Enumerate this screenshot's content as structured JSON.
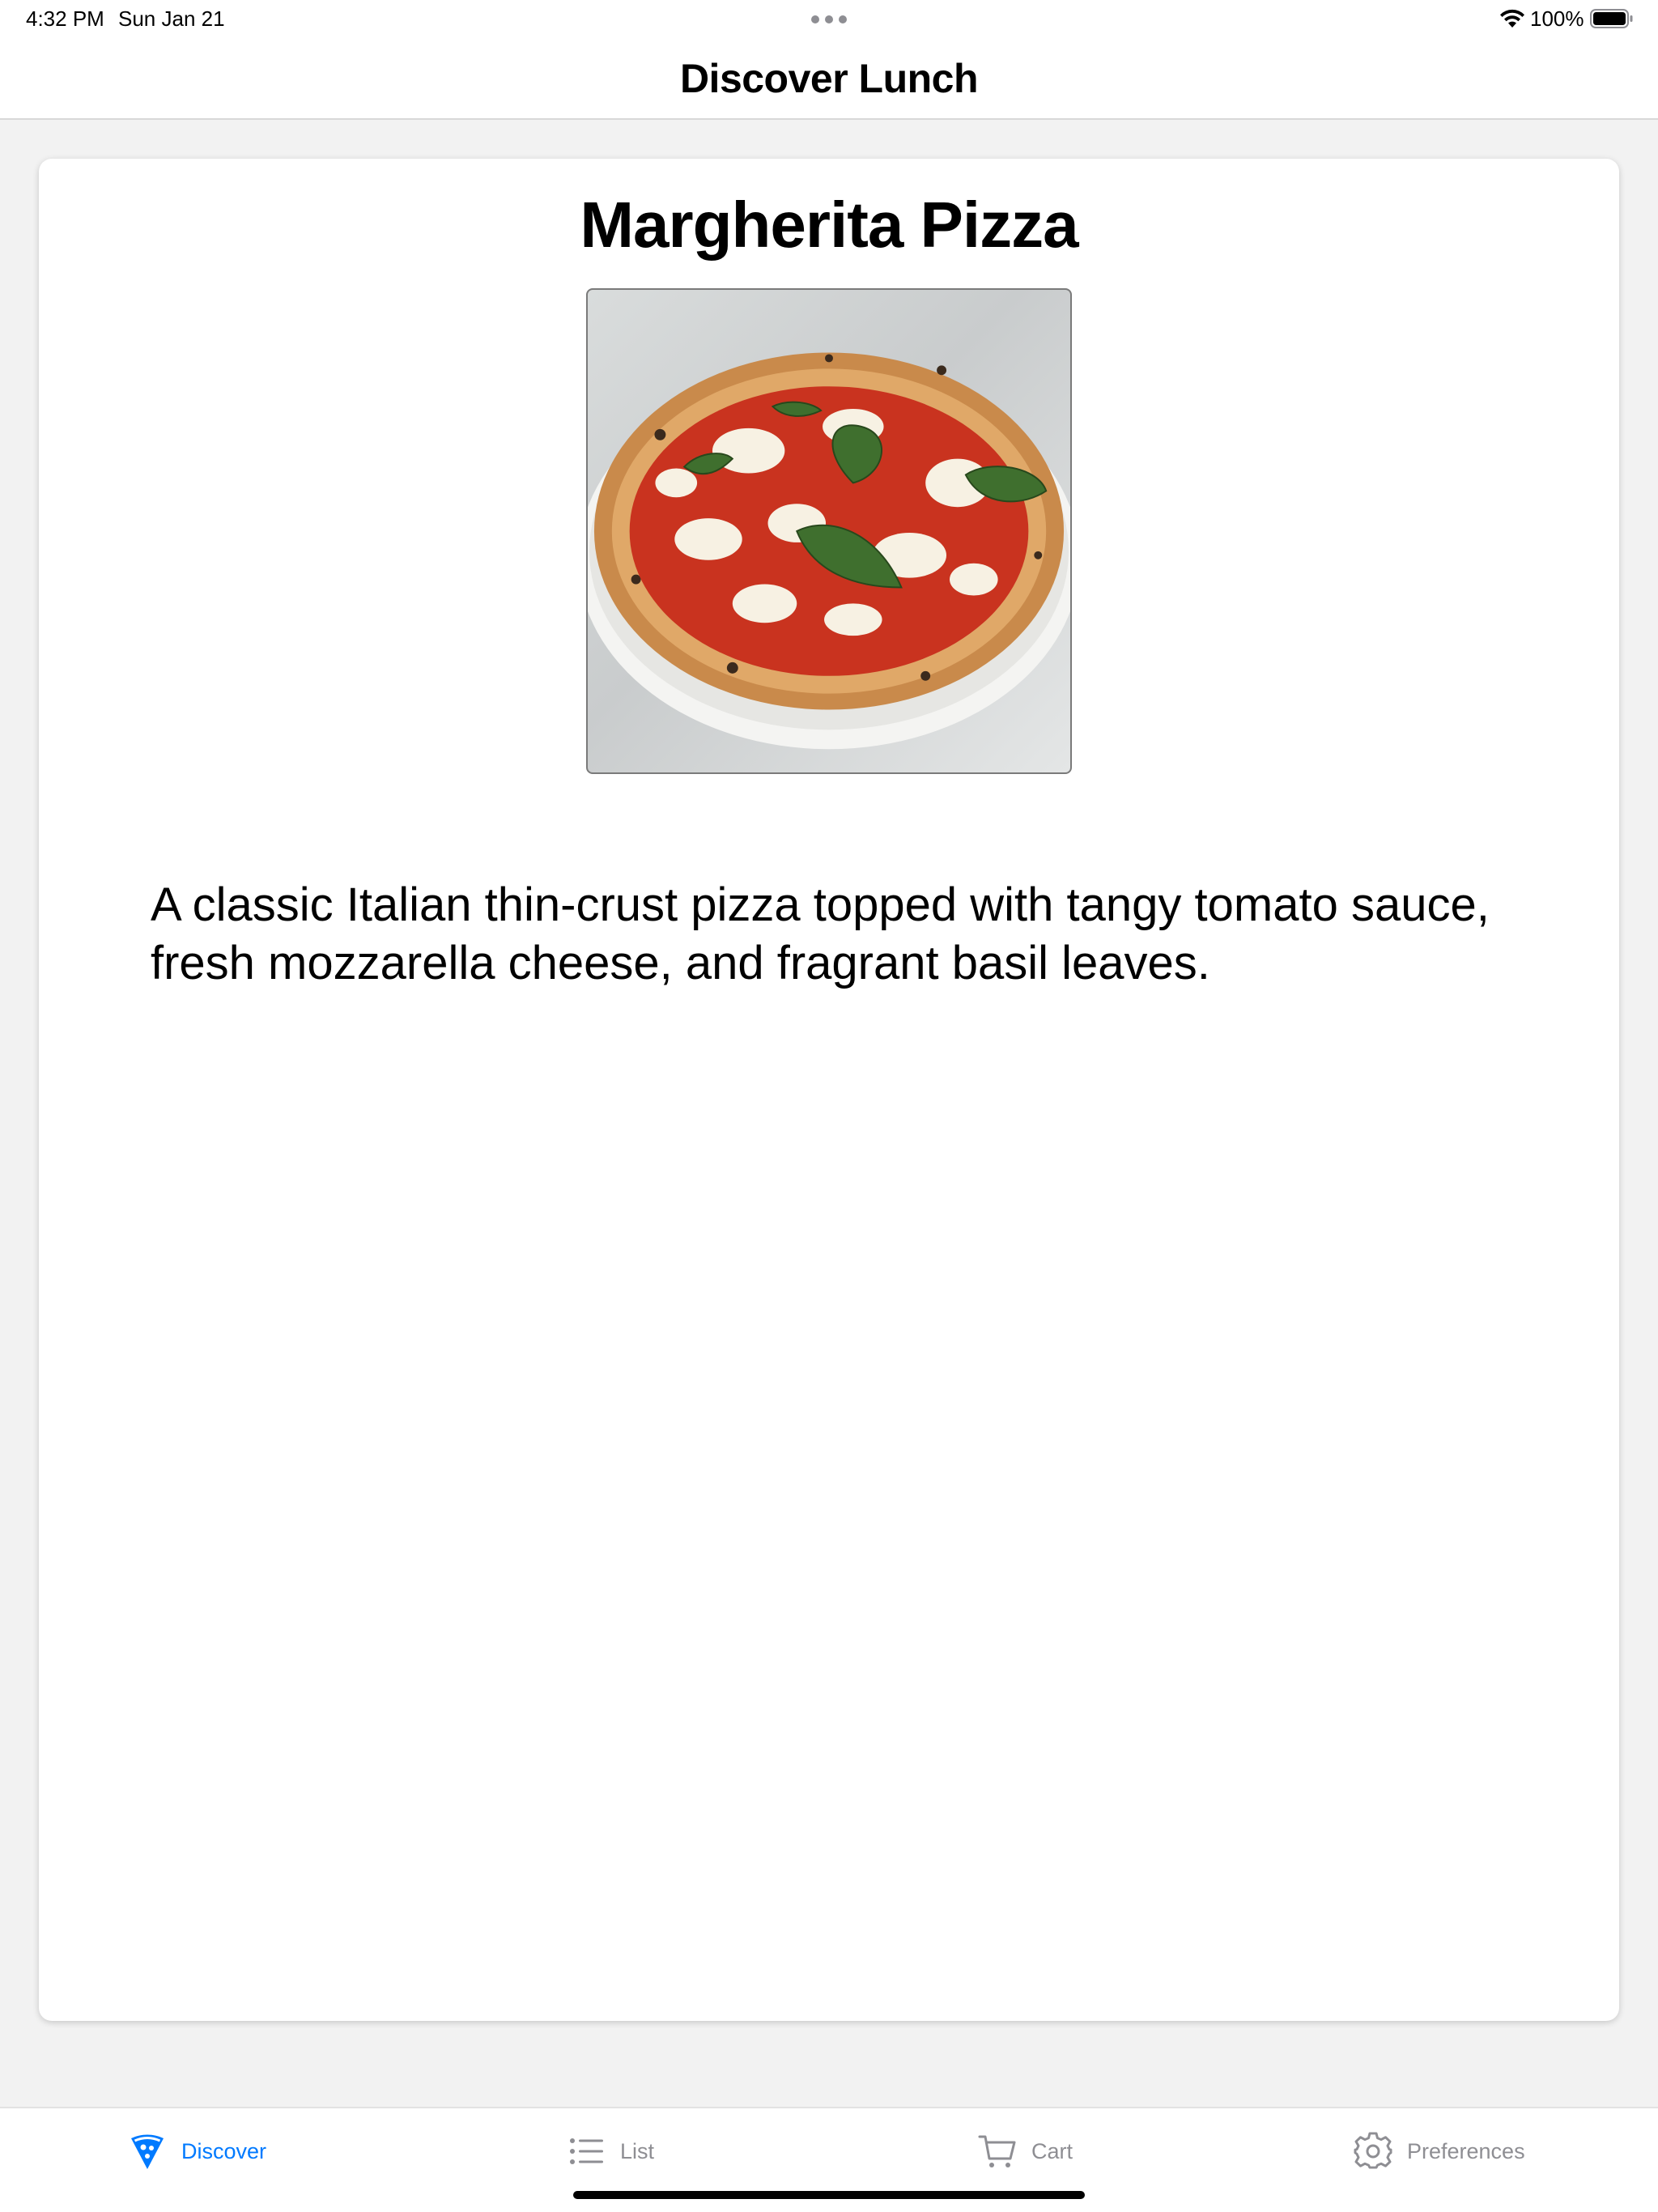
{
  "status_bar": {
    "time": "4:32 PM",
    "date": "Sun Jan 21",
    "battery": "100%",
    "icons": [
      "wifi-icon",
      "battery-icon",
      "multitask-dots-icon"
    ]
  },
  "nav": {
    "title": "Discover Lunch"
  },
  "food": {
    "name": "Margherita Pizza",
    "image_icon": "pizza-photo",
    "description": "A classic Italian thin-crust pizza topped with tangy tomato sauce, fresh mozzarella cheese, and fragrant basil leaves."
  },
  "tabs": [
    {
      "label": "Discover",
      "icon": "pizza-slice-icon",
      "active": true
    },
    {
      "label": "List",
      "icon": "list-icon",
      "active": false
    },
    {
      "label": "Cart",
      "icon": "cart-icon",
      "active": false
    },
    {
      "label": "Preferences",
      "icon": "gear-icon",
      "active": false
    }
  ],
  "colors": {
    "accent": "#007aff",
    "inactive": "#8e8e93",
    "background": "#f2f2f2",
    "card": "#ffffff"
  }
}
